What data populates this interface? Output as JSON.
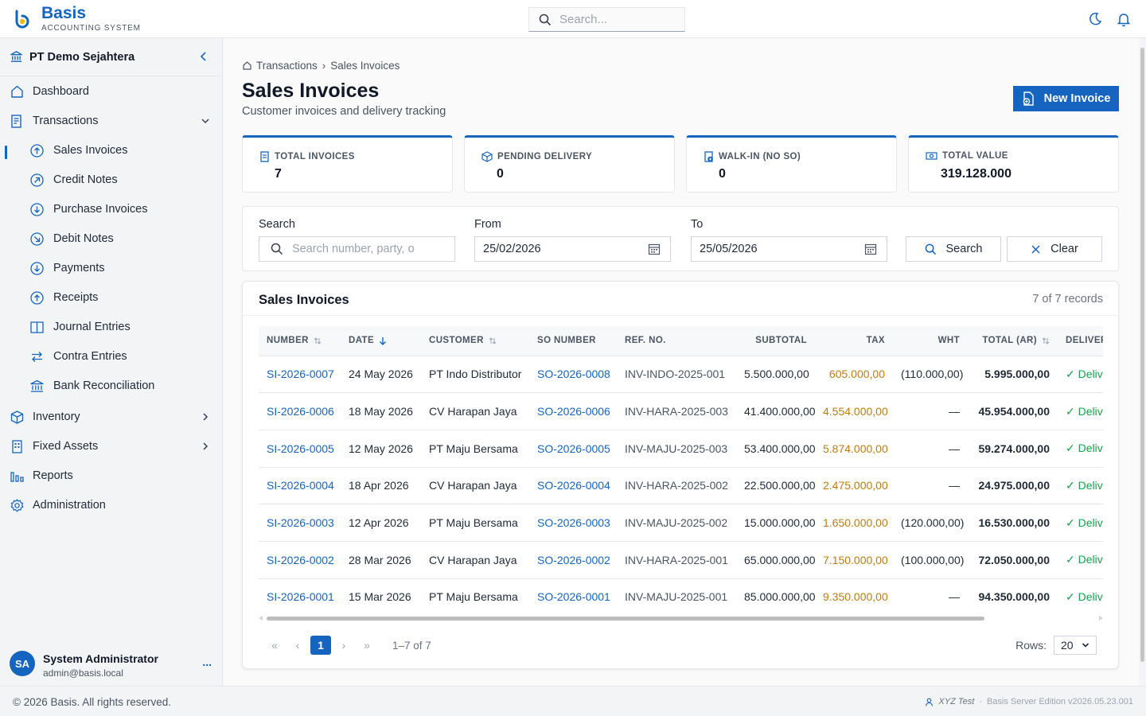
{
  "app": {
    "name": "Basis",
    "tagline": "ACCOUNTING SYSTEM",
    "search_placeholder": "Search...",
    "accent": "#1565c0"
  },
  "sidebar": {
    "org": "PT Demo Sejahtera",
    "items": [
      {
        "label": "Dashboard",
        "icon": "home-icon"
      },
      {
        "label": "Transactions",
        "icon": "receipt-icon",
        "expanded": true,
        "children": [
          {
            "label": "Sales Invoices",
            "icon": "arrow-up-circle-icon",
            "active": true
          },
          {
            "label": "Credit Notes",
            "icon": "arrow-up-right-circle-icon"
          },
          {
            "label": "Purchase Invoices",
            "icon": "arrow-down-circle-icon"
          },
          {
            "label": "Debit Notes",
            "icon": "arrow-down-right-circle-icon"
          },
          {
            "label": "Payments",
            "icon": "arrow-down-circle-icon"
          },
          {
            "label": "Receipts",
            "icon": "arrow-up-circle-icon"
          },
          {
            "label": "Journal Entries",
            "icon": "book-icon"
          },
          {
            "label": "Contra Entries",
            "icon": "swap-icon"
          },
          {
            "label": "Bank Reconciliation",
            "icon": "bank-icon"
          }
        ]
      },
      {
        "label": "Inventory",
        "icon": "box-icon"
      },
      {
        "label": "Fixed Assets",
        "icon": "building-icon"
      },
      {
        "label": "Reports",
        "icon": "bar-chart-icon"
      },
      {
        "label": "Administration",
        "icon": "gear-icon"
      }
    ],
    "user": {
      "initials": "SA",
      "name": "System Administrator",
      "email": "admin@basis.local",
      "more": "..."
    }
  },
  "page": {
    "breadcrumb": [
      "Transactions",
      "Sales Invoices"
    ],
    "breadcrumb_sep": "›",
    "title": "Sales Invoices",
    "subtitle": "Customer invoices and delivery tracking",
    "new_button": "New Invoice"
  },
  "stats": [
    {
      "label": "TOTAL INVOICES",
      "value": "7",
      "icon": "document-icon"
    },
    {
      "label": "PENDING DELIVERY",
      "value": "0",
      "icon": "package-icon"
    },
    {
      "label": "WALK-IN (NO SO)",
      "value": "0",
      "icon": "document-plus-icon"
    },
    {
      "label": "TOTAL VALUE",
      "value": "319.128.000",
      "icon": "money-icon"
    }
  ],
  "filters": {
    "search_label": "Search",
    "search_placeholder": "Search number, party, o",
    "from_label": "From",
    "from_value": "25/02/2026",
    "to_label": "To",
    "to_value": "25/05/2026",
    "search_button": "Search",
    "clear_button": "Clear"
  },
  "table": {
    "title": "Sales Invoices",
    "count": "7 of 7 records",
    "columns": [
      "NUMBER",
      "DATE",
      "CUSTOMER",
      "SO NUMBER",
      "REF. NO.",
      "SUBTOTAL",
      "TAX",
      "WHT",
      "TOTAL (AR)",
      "DELIVERY"
    ],
    "rows": [
      [
        "SI-2026-0007",
        "24 May 2026",
        "PT Indo Distributor",
        "SO-2026-0008",
        "INV-INDO-2025-001",
        "5.500.000,00",
        "605.000,00",
        "(110.000,00)",
        "5.995.000,00",
        "✓ Delivered"
      ],
      [
        "SI-2026-0006",
        "18 May 2026",
        "CV Harapan Jaya",
        "SO-2026-0006",
        "INV-HARA-2025-003",
        "41.400.000,00",
        "4.554.000,00",
        "—",
        "45.954.000,00",
        "✓ Delivered"
      ],
      [
        "SI-2026-0005",
        "12 May 2026",
        "PT Maju Bersama",
        "SO-2026-0005",
        "INV-MAJU-2025-003",
        "53.400.000,00",
        "5.874.000,00",
        "—",
        "59.274.000,00",
        "✓ Delivered"
      ],
      [
        "SI-2026-0004",
        "18 Apr 2026",
        "CV Harapan Jaya",
        "SO-2026-0004",
        "INV-HARA-2025-002",
        "22.500.000,00",
        "2.475.000,00",
        "—",
        "24.975.000,00",
        "✓ Delivered"
      ],
      [
        "SI-2026-0003",
        "12 Apr 2026",
        "PT Maju Bersama",
        "SO-2026-0003",
        "INV-MAJU-2025-002",
        "15.000.000,00",
        "1.650.000,00",
        "(120.000,00)",
        "16.530.000,00",
        "✓ Delivered"
      ],
      [
        "SI-2026-0002",
        "28 Mar 2026",
        "CV Harapan Jaya",
        "SO-2026-0002",
        "INV-HARA-2025-001",
        "65.000.000,00",
        "7.150.000,00",
        "(100.000,00)",
        "72.050.000,00",
        "✓ Delivered"
      ],
      [
        "SI-2026-0001",
        "15 Mar 2026",
        "PT Maju Bersama",
        "SO-2026-0001",
        "INV-MAJU-2025-001",
        "85.000.000,00",
        "9.350.000,00",
        "—",
        "94.350.000,00",
        "✓ Delivered"
      ]
    ]
  },
  "pagination": {
    "first": "«",
    "prev": "‹",
    "current": "1",
    "next": "›",
    "last": "»",
    "info": "1–7 of 7",
    "rows_label": "Rows:",
    "rows_value": "20"
  },
  "footer": {
    "copyright": "© 2026 Basis. All rights reserved.",
    "tenant": "XYZ Test",
    "sep": "·",
    "edition": "Basis Server Edition v2026.05.23.001"
  }
}
